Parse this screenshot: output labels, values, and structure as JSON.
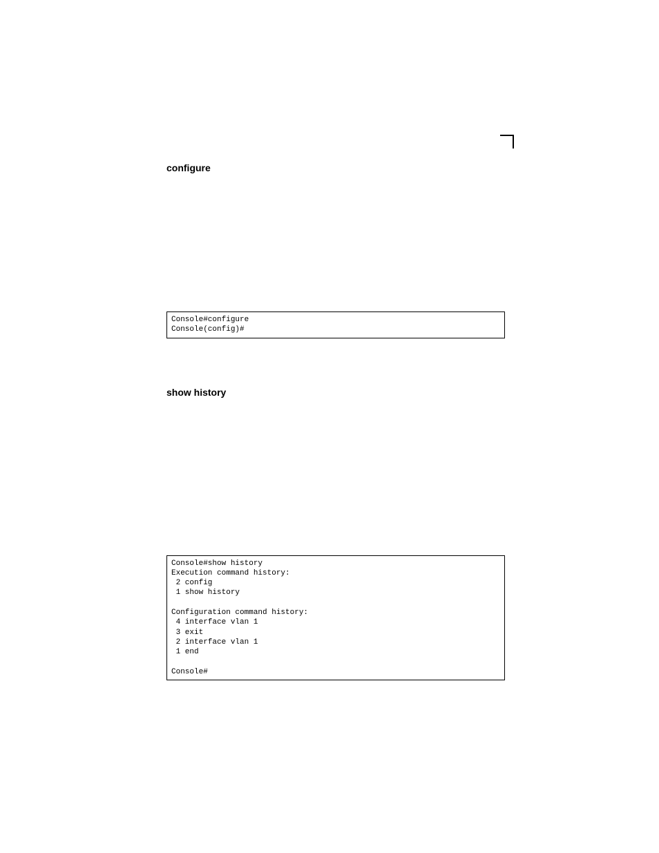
{
  "section1": {
    "heading": "configure",
    "code": "Console#configure\nConsole(config)#"
  },
  "section2": {
    "heading": "show history",
    "code": "Console#show history\nExecution command history:\n 2 config\n 1 show history\n\nConfiguration command history:\n 4 interface vlan 1\n 3 exit\n 2 interface vlan 1\n 1 end\n\nConsole#"
  }
}
